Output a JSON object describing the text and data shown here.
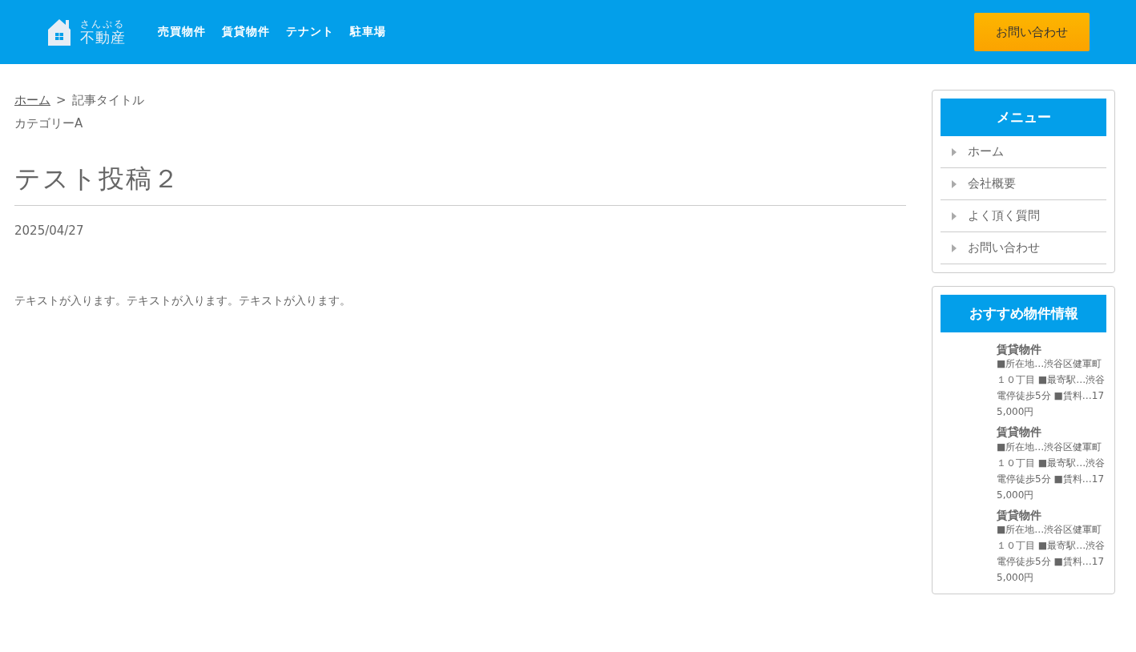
{
  "header": {
    "logo": {
      "small": "さんぷる",
      "main": "不動産"
    },
    "nav": [
      "売買物件",
      "賃貸物件",
      "テナント",
      "駐車場"
    ],
    "contact_button": "お問い合わせ"
  },
  "breadcrumb": {
    "home": "ホーム",
    "separator": ">",
    "current": "記事タイトル"
  },
  "category": "カテゴリーA",
  "article": {
    "title": "テスト投稿２",
    "date": "2025/04/27",
    "body": "テキストが入ります。テキストが入ります。テキストが入ります。"
  },
  "sidebar": {
    "menu": {
      "title": "メニュー",
      "items": [
        "ホーム",
        "会社概要",
        "よく頂く質問",
        "お問い合わせ"
      ]
    },
    "recommended": {
      "title": "おすすめ物件情報",
      "items": [
        {
          "title": "賃貸物件",
          "description": "■所在地…渋谷区健軍町１０丁目 ■最寄駅…渋谷電停徒歩5分 ■賃料…175,000円"
        },
        {
          "title": "賃貸物件",
          "description": "■所在地…渋谷区健軍町１０丁目 ■最寄駅…渋谷電停徒歩5分 ■賃料…175,000円"
        },
        {
          "title": "賃貸物件",
          "description": "■所在地…渋谷区健軍町１０丁目 ■最寄駅…渋谷電停徒歩5分 ■賃料…175,000円"
        }
      ]
    }
  }
}
